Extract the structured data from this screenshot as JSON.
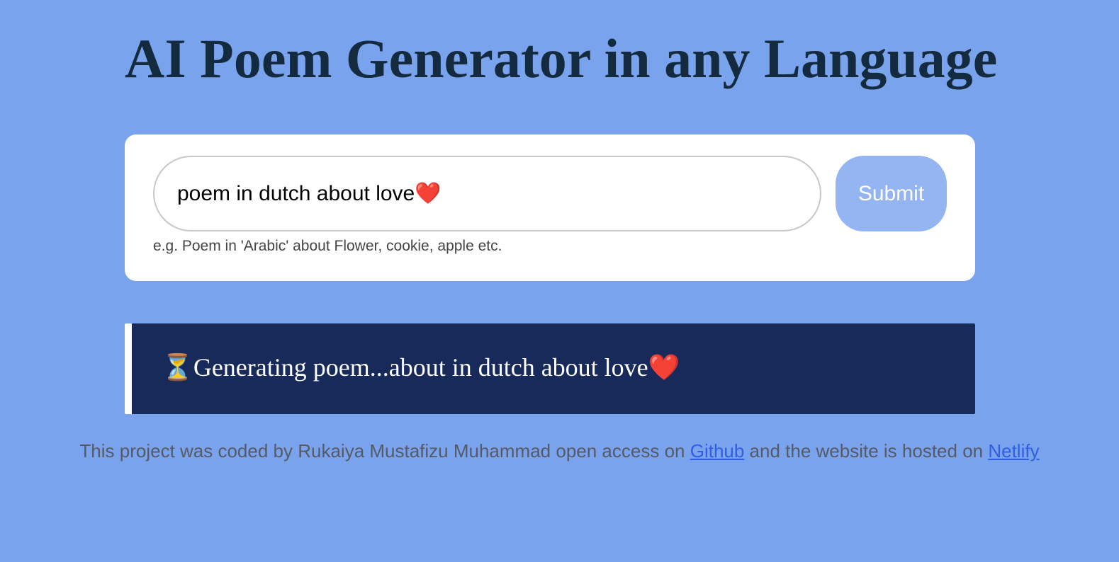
{
  "header": {
    "title": "AI Poem Generator in any Language"
  },
  "form": {
    "input_value": "poem in dutch about love❤️",
    "hint": "e.g. Poem in 'Arabic' about Flower, cookie, apple etc.",
    "submit_label": "Submit"
  },
  "result": {
    "icon": "hourglass-icon",
    "icon_glyph": "⏳",
    "text": "Generating poem...about in dutch about love❤️"
  },
  "footer": {
    "prefix": "This project was coded by Rukaiya Mustafizu Muhammad open access on ",
    "github_link": "Github",
    "middle": " and the website is hosted on ",
    "netlify_link": "Netlify"
  },
  "colors": {
    "background": "#7aa3ee",
    "title": "#142b3f",
    "submit_button": "#94b4f2",
    "result_box": "#172a59",
    "link": "#2f5fe0"
  }
}
